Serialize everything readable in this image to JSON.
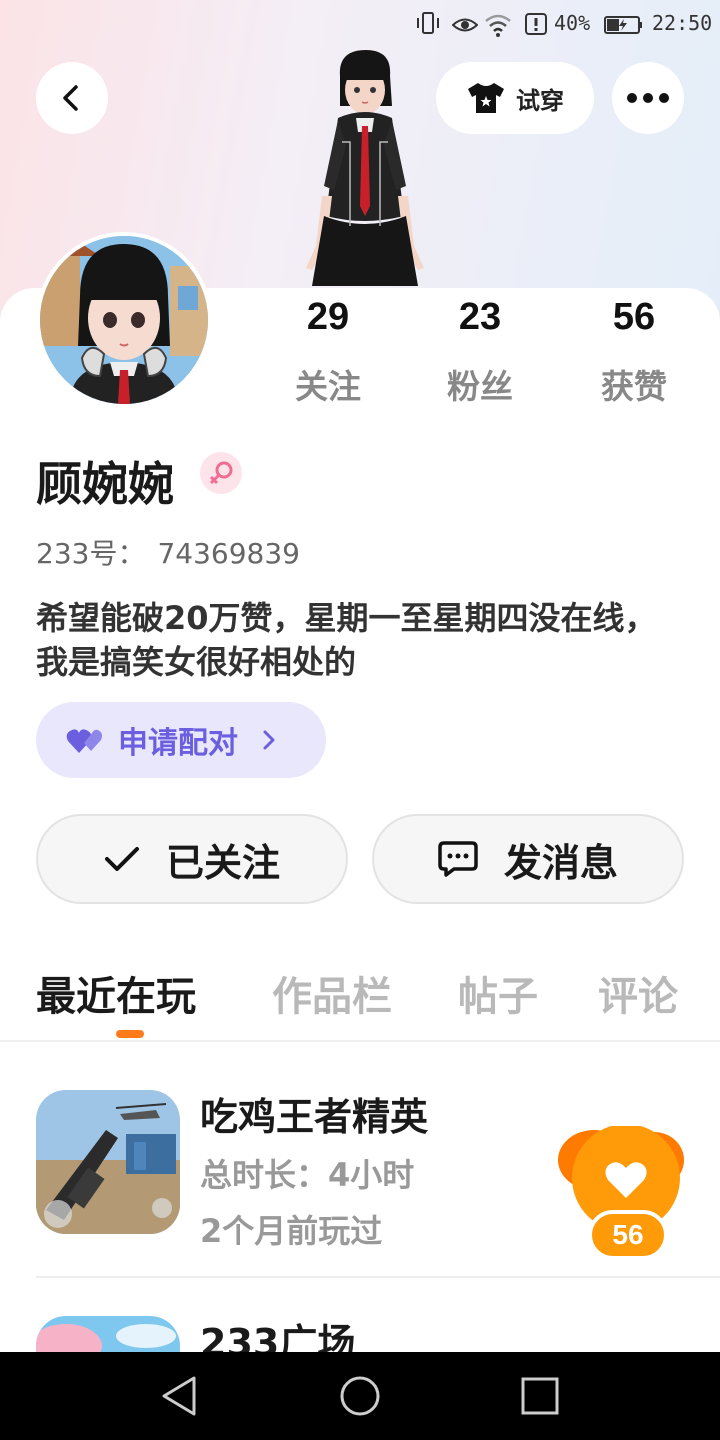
{
  "status_bar": {
    "battery_percent": "40%",
    "time": "22:50",
    "icons": [
      "vibrate-icon",
      "eye-icon",
      "wifi-icon",
      "alert-icon",
      "battery-charging-icon"
    ]
  },
  "header": {
    "tryon_label": "试穿",
    "icons": [
      "back-icon",
      "tshirt-icon",
      "more-icon"
    ]
  },
  "profile": {
    "stats": [
      {
        "value": "29",
        "label": "关注"
      },
      {
        "value": "23",
        "label": "粉丝"
      },
      {
        "value": "56",
        "label": "获赞"
      }
    ],
    "name": "顾婉婉",
    "gender_icon": "female-icon",
    "uid_label": "233号：",
    "uid_value": "74369839",
    "bio": "希望能破20万赞，星期一至星期四没在线，我是搞笑女很好相处的",
    "match_label": "申请配对",
    "follow_label": "已关注",
    "message_label": "发消息"
  },
  "tabs": [
    {
      "label": "最近在玩",
      "active": true
    },
    {
      "label": "作品栏",
      "active": false
    },
    {
      "label": "帖子",
      "active": false
    },
    {
      "label": "评论",
      "active": false
    }
  ],
  "games": [
    {
      "title": "吃鸡王者精英",
      "duration": "总时长：4小时",
      "last_played": "2个月前玩过"
    },
    {
      "title": "233广场"
    }
  ],
  "like_float": {
    "count": "56"
  },
  "colors": {
    "accent_orange": "#ff9a08",
    "match_purple": "#6b5fe0",
    "female_pink": "#f36c92"
  }
}
